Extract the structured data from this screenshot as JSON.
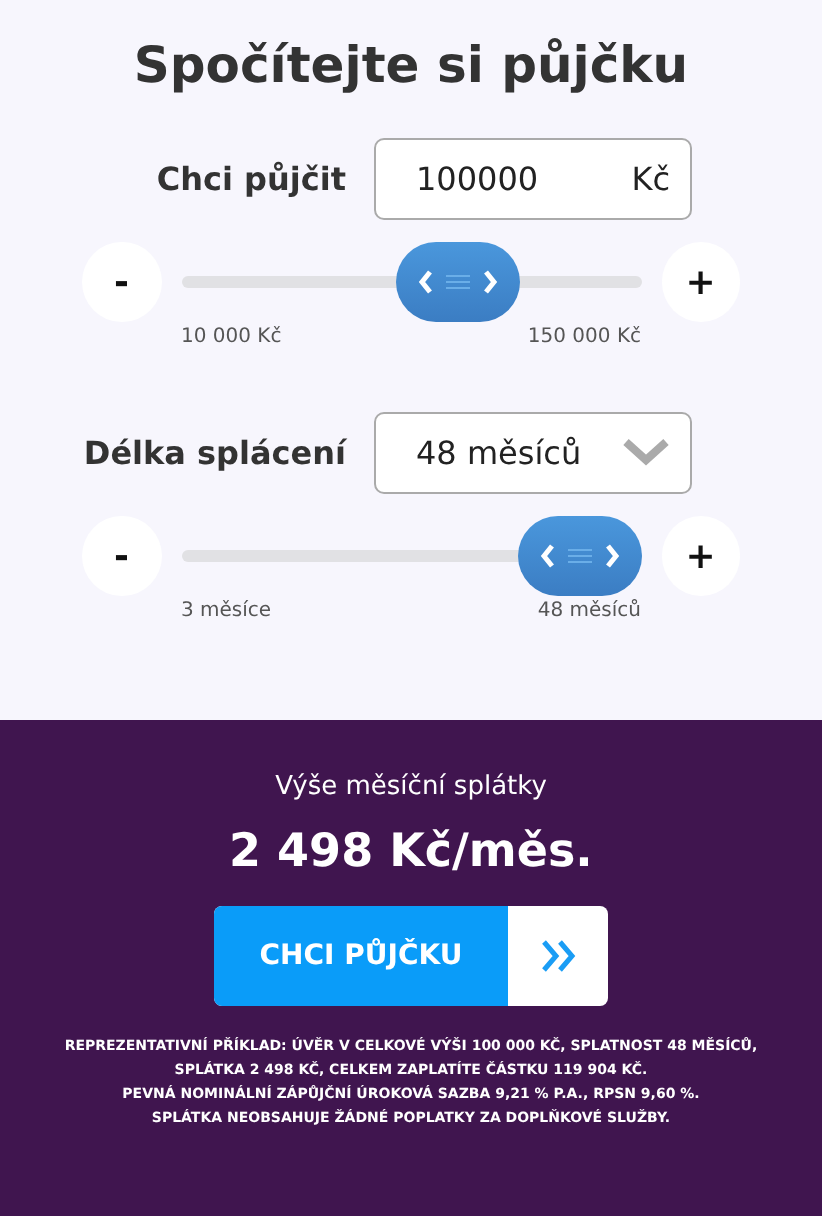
{
  "title": "Spočítejte si půjčku",
  "amount": {
    "label": "Chci půjčit",
    "value": "100000",
    "unit": "Kč"
  },
  "amount_slider": {
    "minus": "-",
    "plus": "+",
    "level": 0.64,
    "min_label": "10 000 Kč",
    "max_label": "150 000 Kč"
  },
  "term": {
    "label": "Délka splácení",
    "value": "48 měsíců"
  },
  "term_slider": {
    "minus": "-",
    "plus": "+",
    "level": 1,
    "min_label": "3 měsíce",
    "max_label": "48 měsíců"
  },
  "result": {
    "label": "Výše měsíční splátky",
    "amount": "2 498 Kč/měs."
  },
  "cta": {
    "label": "CHCI PŮJČKU"
  },
  "disclaimer": [
    "REPREZENTATIVNÍ PŘÍKLAD: ÚVĚR V CELKOVÉ VÝŠI 100 000 KČ, SPLATNOST 48 MĚSÍCŮ,",
    "SPLÁTKA 2 498 KČ, CELKEM ZAPLATÍTE ČÁSTKU 119 904 KČ.",
    "PEVNÁ NOMINÁLNÍ ZÁPŮJČNÍ ÚROKOVÁ SAZBA 9,21 % P.A., RPSN 9,60 %.",
    "SPLÁTKA NEOBSAHUJE ŽÁDNÉ POPLATKY ZA DOPLŇKOVÉ SLUŽBY."
  ]
}
